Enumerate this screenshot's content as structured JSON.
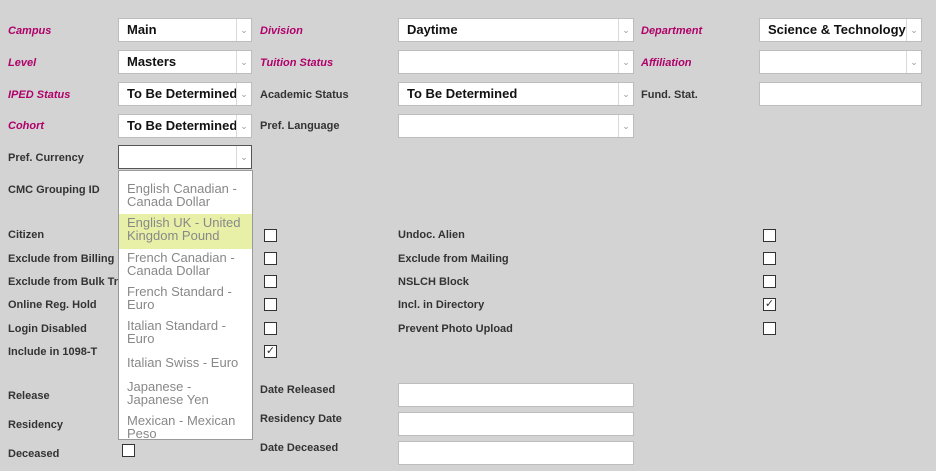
{
  "fields": {
    "campus": {
      "label": "Campus",
      "value": "Main"
    },
    "division": {
      "label": "Division",
      "value": "Daytime"
    },
    "department": {
      "label": "Department",
      "value": "Science & Technology"
    },
    "level": {
      "label": "Level",
      "value": "Masters"
    },
    "tuition_status": {
      "label": "Tuition Status",
      "value": ""
    },
    "affiliation": {
      "label": "Affiliation",
      "value": ""
    },
    "iped_status": {
      "label": "IPED Status",
      "value": "To Be Determined"
    },
    "academic_status": {
      "label": "Academic Status",
      "value": "To Be Determined"
    },
    "fund_stat": {
      "label": "Fund. Stat.",
      "value": ""
    },
    "cohort": {
      "label": "Cohort",
      "value": "To Be Determined"
    },
    "pref_language": {
      "label": "Pref. Language",
      "value": ""
    },
    "pref_currency": {
      "label": "Pref. Currency",
      "value": ""
    },
    "cmc_grouping_id": {
      "label": "CMC Grouping ID"
    }
  },
  "currency_options": [
    "English Canadian - Canada Dollar",
    "English UK - United Kingdom Pound",
    "French Canadian - Canada Dollar",
    "French Standard - Euro",
    "Italian Standard - Euro",
    "Italian Swiss - Euro",
    "Japanese - Japanese Yen",
    "Mexican - Mexican Peso"
  ],
  "highlighted_option_index": 1,
  "checkboxes_left": [
    {
      "label": "Citizen",
      "checked": false
    },
    {
      "label": "Exclude from Billing",
      "checked": false
    },
    {
      "label": "Exclude from Bulk Tra",
      "checked": false
    },
    {
      "label": "Online Reg. Hold",
      "checked": false
    },
    {
      "label": "Login Disabled",
      "checked": false
    },
    {
      "label": "Include in 1098-T",
      "checked": true
    }
  ],
  "checkboxes_right": [
    {
      "label": "Undoc. Alien",
      "checked": false
    },
    {
      "label": "Exclude from Mailing",
      "checked": false
    },
    {
      "label": "NSLCH Block",
      "checked": false
    },
    {
      "label": "Incl. in Directory",
      "checked": true
    },
    {
      "label": "Prevent Photo Upload",
      "checked": false
    }
  ],
  "bottom": {
    "release": "Release",
    "residency": "Residency",
    "deceased": "Deceased",
    "deceased_checked": false,
    "date_released": "Date Released",
    "residency_date": "Residency Date",
    "date_deceased": "Date Deceased"
  },
  "colors": {
    "required_label": "#b0006a",
    "highlight": "#e8f0a8",
    "background": "#d3d3d3"
  },
  "icons": {
    "dropdown_arrow": "chevron-down-icon",
    "check": "check-icon"
  }
}
